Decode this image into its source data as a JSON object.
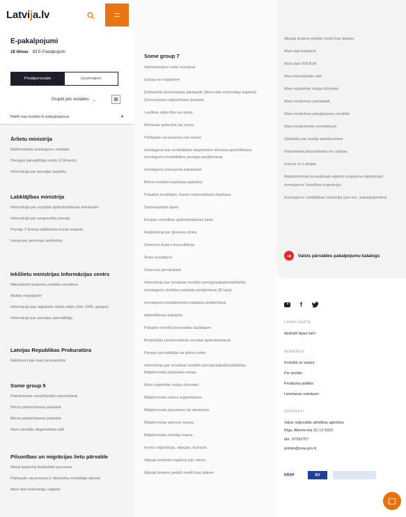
{
  "brand": {
    "logo_pre": "Latvi",
    "logo_accent": "j",
    "logo_post": "a.lv"
  },
  "page": {
    "title": "E-pakalpojumi",
    "themes": "18 tēmas",
    "services": "83 E-Pakalpojumi"
  },
  "toggle": {
    "private": "Privātpersonām",
    "business": "Uzņēmējiem"
  },
  "group_by": "Grupēt pēc iestādes",
  "select_all": "Rādīt visu iestāžu E-pakalpojumus",
  "left_categories": [
    {
      "title": "Ārlietu ministrija",
      "items": [
        "Elektroniskās iesniegumu iestādei",
        "Pensijas pārvaldītāja izvēle (2.līmenis)",
        "Informācija par pensijas kapitālu"
      ]
    },
    {
      "title": "Labklājības ministrija",
      "items": [
        "Informācija par sociālās apdrošināšanas iemaksām",
        "Informācija par prognozēto pensiju",
        "Pensiju 2.līmeņa dalībnieka konta izraksts",
        "Izziņa par personas sodāmību"
      ]
    },
    {
      "title": "Iekšlietu ministrijas Informācijas centrs",
      "items": [
        "Nekustamā īpašuma nodokļa nomaksa",
        "Muitas maksājumi",
        "Informācija par reģistrēto darba stāžu (līdz 1996. gadam)",
        "Informācija par pensijas pārvaldītāju"
      ]
    },
    {
      "title": "Latvijas Republikas Prokuratūra",
      "items": [
        "Nolēmumi par mani prokuratūrā"
      ]
    },
    {
      "title": "Some group 5",
      "items": [
        "Pieteikšanās uzturlīdzekļu saņemšanai",
        "Bērna piedzimšanas pabalsts",
        "Bērna piedzimšanas pabalsts",
        "Mani vizuālās diagnostikas dati"
      ]
    },
    {
      "title": "Pilsonības un migrācijas lietu pārvalde",
      "items": [
        "Manā īpašumā deklarētās personas",
        "Pārbaude vai persona ir deklarēta norādītajā adresē",
        "Mani dati Iedzīvotāju reģistrā"
      ]
    }
  ],
  "middle": {
    "title": "Some group 7",
    "items": [
      "Administratīvo sodu nomaksa",
      "Izziņas no reģistriem",
      "Deklarētās dzīvesvietas pārbaude (Mani dati Iedzīvotāju reģistrā)",
      "Dzīvesvietas reģistrēšana ārvalstīs",
      "Laulības apliecība vai izziņa",
      "Miršanas apliecība vai izziņa",
      "Pārbaude vai persona nav mirusi",
      "Iesniegums par invaliditātes ekspertīzes lēmuma apstrīdēšanu",
      "Iesniegums invaliditātes pensijas piešķiršanai",
      "Iesniegums transporta pabalstam",
      "Bērna invalīda kopšanas pabalsts",
      "Pabalsts invalīdam, kuram nepieciešama kopšana",
      "Darbnespējas lapas",
      "Eiropas veselības apdrošināšanas karte",
      "Reģistrācija pie ģimenes ārsta",
      "Ģimenes ārsta e-konsultācija",
      "Ārsta nosūtījumi",
      "Ziņas par pierakstiem",
      "Informācija par izmaksai nosūtīto pensiju/pabalstu/atlīdzību",
      "Iesniegums slimības pabalsta piešķiršanai (B lapa)",
      "Iesniegums bezdarbnieka pabalsta piešķiršanai",
      "Apbedīšanas pabalsts",
      "Pabalsts mirušā pensionāra laulātajam",
      "Brīvprātīga pievienošanās sociālai apdrošināšanai",
      "Pensiju pārvaldītāja vai plāna izvēle",
      "Informācija par izmaksai nosūtīto pensiju/pabalstu/atlīdzību",
      "Mājdzīvnieka īpašnieka maiņa",
      "Mani reģistrētie mājas dzīvnieki",
      "Mājdzīvnieka nāves reģistrēšanai",
      "Mājdzīvnieka pazušana vai atrašanās",
      "Mājdzīvnieka adreses maiņa",
      "Mājdzīvnieka turētāja maiņa",
      "Ieroču reģistrācija, atļaujas, licences",
      "Atļauja izmantot orgānus pēc nāves",
      "Atļauja ārstiem piekļūt medicīnas datiem"
    ]
  },
  "right": {
    "items": [
      "Atļauja ārstiem piekļūt medicīnas datiem",
      "Mani dati kadastrā",
      "Mani dati VDEĀVK",
      "Mani biometriskie dati",
      "Mani reģistrētie mājas dzīvnieki",
      "Mani medicīnas pamatdati",
      "Mani medicīnas pakalpojumu rezultāti",
      "Mani medicīniskie izmeklējumi",
      "Statistika par studiju pieteikumiem",
      "Dokumenta pieprasīšana no Latvijas",
      "Izziņas no Latvijas",
      "Reģistrēšanās konsulārajā reģistrā (ceļojuma reģistrācija)",
      "Iesniegums Veselības inspekcijai",
      "Iesniegums Labklājības ministrijai (par soc. pakalpojumiem)"
    ],
    "catalog_link": "Valsts pārvaldes pakalpojumu katalogs"
  },
  "footer": {
    "map_heading": "LAPAS KARTE",
    "map_link": "Apskatīt lapas karti",
    "useful_heading": "NODERĪGI",
    "useful_links": [
      "Kontakti un saziņa",
      "Par portālu",
      "Privātuma politika",
      "Lietošanas noteikumi"
    ],
    "contacts_heading": "KONTAKTI",
    "contacts": [
      "Valsts reģionālās attīstības aģentūra",
      "Rīga, Alberta iela 10, LV-1010",
      "tālr.: 67502757",
      "portals@vraa.gov.lv"
    ],
    "logo_eraf": "ERAF",
    "logo_eu": "EU"
  }
}
